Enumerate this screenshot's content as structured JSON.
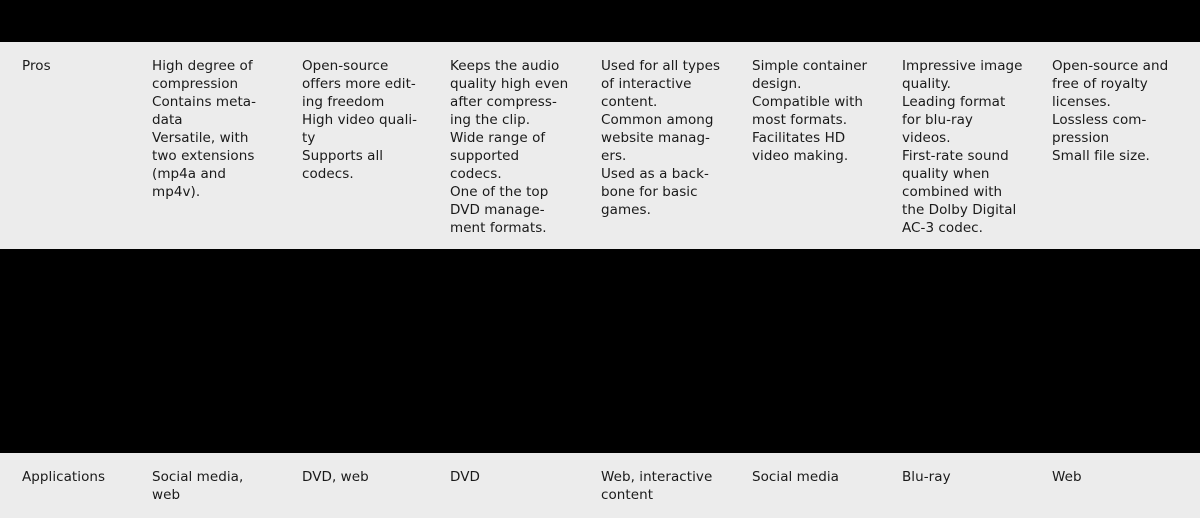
{
  "colors": {
    "panel_background": "#ececec",
    "band_background": "#000000",
    "text": "#1a1a1a"
  },
  "table": {
    "rows": [
      {
        "label": "Pros",
        "cells": [
          "High degree of\ncompression\nContains meta-\ndata\nVersatile, with\ntwo extensions\n(mp4a and\nmp4v).",
          "Open-source\noffers more edit-\ning freedom\nHigh video quali-\nty\nSupports all\ncodecs.",
          "Keeps the audio\nquality high even\nafter compress-\ning the clip.\nWide range of\nsupported\ncodecs.\nOne of the top\nDVD manage-\nment formats.",
          "Used for all types\nof interactive\ncontent.\nCommon among\nwebsite manag-\ners.\nUsed as a back-\nbone for basic\ngames.",
          "Simple container\ndesign.\nCompatible with\nmost formats.\nFacilitates HD\nvideo making.",
          "Impressive image\nquality.\nLeading format\nfor blu-ray\nvideos.\nFirst-rate sound\nquality when\ncombined with\nthe Dolby Digital\nAC-3 codec.",
          "Open-source and\nfree of royalty\nlicenses.\nLossless com-\npression\nSmall file size."
        ]
      },
      {
        "label": "Applications",
        "cells": [
          "Social media,\nweb",
          "DVD, web",
          "DVD",
          "Web, interactive\ncontent",
          "Social media",
          "Blu-ray",
          "Web"
        ]
      }
    ]
  }
}
